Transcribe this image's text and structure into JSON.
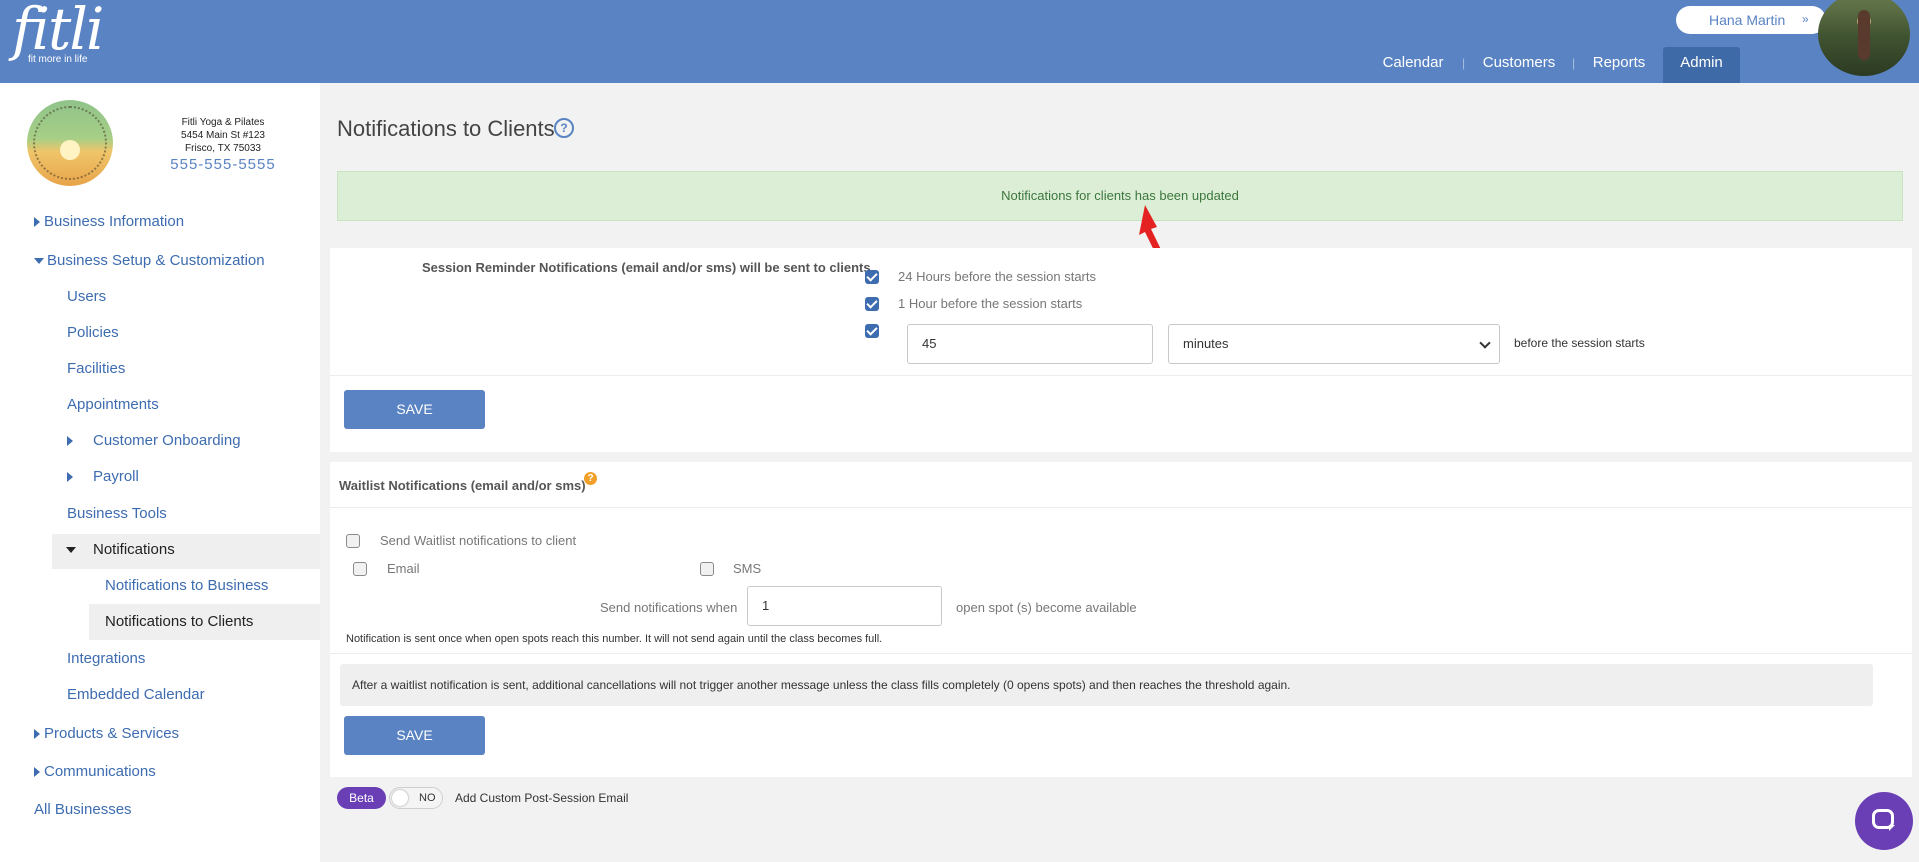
{
  "app": {
    "logo_text": "fitli",
    "logo_tagline": "fit more in life",
    "user_name": "Hana Martin",
    "user_chevron": "»"
  },
  "nav": {
    "items": [
      {
        "label": "Calendar"
      },
      {
        "label": "Customers"
      },
      {
        "label": "Reports"
      },
      {
        "label": "Admin",
        "active": true
      }
    ],
    "separator": "|"
  },
  "business": {
    "name": "Fitli Yoga & Pilates",
    "address1": "5454 Main St #123",
    "address2": "Frisco, TX 75033",
    "phone": "555-555-5555"
  },
  "sidebar": {
    "items": [
      {
        "label": "Business Information"
      },
      {
        "label": "Business Setup & Customization"
      },
      {
        "label": "Users"
      },
      {
        "label": "Policies"
      },
      {
        "label": "Facilities"
      },
      {
        "label": "Appointments"
      },
      {
        "label": "Customer Onboarding"
      },
      {
        "label": "Payroll"
      },
      {
        "label": "Business Tools"
      },
      {
        "label": "Notifications"
      },
      {
        "label": "Notifications to Business"
      },
      {
        "label": "Notifications to Clients",
        "selected": true
      },
      {
        "label": "Integrations"
      },
      {
        "label": "Embedded Calendar"
      },
      {
        "label": "Products & Services"
      },
      {
        "label": "Communications"
      },
      {
        "label": "All Businesses"
      }
    ]
  },
  "main": {
    "title": "Notifications to Clients",
    "help_glyph": "?",
    "alert": "Notifications for clients has been updated",
    "reminders": {
      "label": "Session Reminder Notifications (email and/or sms) will be sent to clients",
      "option_24h": "24 Hours before the session starts",
      "option_24h_checked": true,
      "option_1h": "1 Hour before the session starts",
      "option_1h_checked": true,
      "custom_checked": true,
      "custom_value": "45",
      "custom_unit": "minutes",
      "custom_suffix": "before the session starts",
      "save_label": "SAVE"
    },
    "waitlist": {
      "title": "Waitlist Notifications (email and/or sms)",
      "help_glyph": "?",
      "send_label": "Send Waitlist notifications to client",
      "send_checked": false,
      "email_label": "Email",
      "email_checked": false,
      "sms_label": "SMS",
      "sms_checked": false,
      "when_label": "Send notifications when",
      "when_value": "1",
      "when_suffix": "open spot (s) become available",
      "note": "Notification is sent once when open spots reach this number. It will not send again until the class becomes full.",
      "info": "After a waitlist notification is sent, additional cancellations will not trigger another message unless the class fills completely (0 opens spots) and then reaches the threshold again.",
      "save_label": "SAVE"
    },
    "custom_email": {
      "beta_label": "Beta",
      "toggle_state": "NO",
      "label": "Add Custom Post-Session Email"
    }
  },
  "colors": {
    "header": "#5a83c3",
    "nav_active": "#3f6aa8",
    "link": "#3d6cb0",
    "alert_bg": "#dcefd6",
    "alert_text": "#3c763d",
    "beta": "#6a3fb5",
    "help_badge": "#f0a028"
  },
  "icons": {
    "help": "question-circle-icon",
    "chat": "chat-bubble-icon",
    "user_chevron": "double-chevron-down-icon"
  }
}
